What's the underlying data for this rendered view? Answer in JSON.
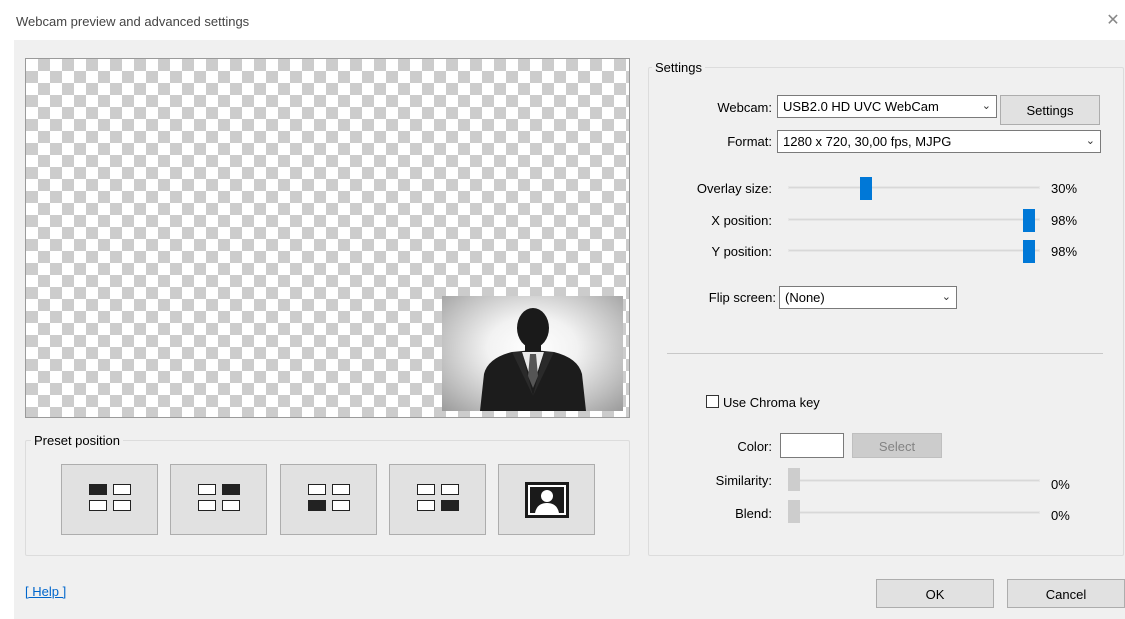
{
  "window": {
    "title": "Webcam preview and advanced settings",
    "close_glyph": "✕"
  },
  "preset": {
    "group_label": "Preset position",
    "buttons": [
      {
        "name": "top-left",
        "active": 0
      },
      {
        "name": "top-right",
        "active": 1
      },
      {
        "name": "bottom-left",
        "active": 2
      },
      {
        "name": "bottom-right",
        "active": 3
      },
      {
        "name": "fullscreen",
        "icon": "person-icon"
      }
    ]
  },
  "settings": {
    "group_label": "Settings",
    "webcam_label": "Webcam:",
    "webcam_value": "USB2.0 HD UVC WebCam",
    "webcam_settings_button": "Settings",
    "format_label": "Format:",
    "format_value": "1280 x 720, 30,00 fps, MJPG",
    "overlay_size_label": "Overlay size:",
    "overlay_size_value": "30%",
    "overlay_size_level": 0.3,
    "x_position_label": "X position:",
    "x_position_value": "98%",
    "x_position_level": 0.98,
    "y_position_label": "Y position:",
    "y_position_value": "98%",
    "y_position_level": 0.98,
    "flip_label": "Flip screen:",
    "flip_value": "(None)",
    "chroma_label": "Use Chroma key",
    "chroma_checked": false,
    "color_label": "Color:",
    "select_button": "Select",
    "similarity_label": "Similarity:",
    "similarity_value": "0%",
    "blend_label": "Blend:",
    "blend_value": "0%"
  },
  "footer": {
    "help_link": "[ Help ]",
    "ok_button": "OK",
    "cancel_button": "Cancel"
  },
  "colors": {
    "accent": "#0078d7",
    "dialog_bg": "#f0f0f0",
    "link": "#0066cc"
  }
}
